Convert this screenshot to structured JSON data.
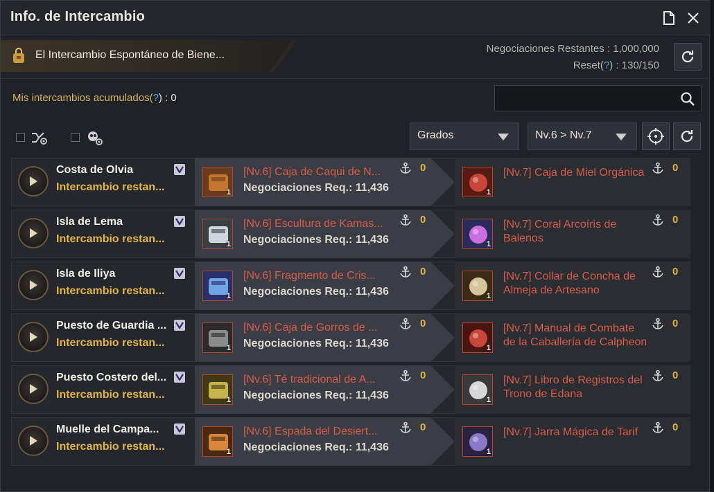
{
  "window": {
    "title": "Info. de Intercambio"
  },
  "banner": {
    "text": "El Intercambio Espontáneo de Biene..."
  },
  "status": {
    "negotiations_label": "Negociaciones Restantes : 1,000,000",
    "reset_prefix": "Reset(",
    "reset_q": "?",
    "reset_suffix": ") : 130/150"
  },
  "accum": {
    "prefix": "Mis intercambios acumulados(",
    "q": "?",
    "suffix": ") : 0"
  },
  "search": {
    "placeholder": ""
  },
  "filters": {
    "grade_label": "Grados",
    "level_label": "Nv.6 > Nv.7"
  },
  "rows": [
    {
      "town": "Costa de Olvia",
      "remain": "Intercambio restan...",
      "give_name": "[Nv.6] Caja de Caqui de N...",
      "give_req": "Negociaciones Req.: 11,436",
      "give_qty": "1",
      "give_count": "0",
      "get_name": "[Nv.7] Caja de Miel Orgánica",
      "get_qty": "1",
      "get_count": "0"
    },
    {
      "town": "Isla de Lema",
      "remain": "Intercambio restan...",
      "give_name": "[Nv.6] Escultura de Kamas...",
      "give_req": "Negociaciones Req.: 11,436",
      "give_qty": "1",
      "give_count": "0",
      "get_name": "[Nv.7] Coral Arcoíris de Balenos",
      "get_qty": "1",
      "get_count": "0"
    },
    {
      "town": "Isla de Iliya",
      "remain": "Intercambio restan...",
      "give_name": "[Nv.6] Fragmento de Cris...",
      "give_req": "Negociaciones Req.: 11,436",
      "give_qty": "1",
      "give_count": "0",
      "get_name": "[Nv.7] Collar de Concha de Almeja de Artesano",
      "get_qty": "1",
      "get_count": "0"
    },
    {
      "town": "Puesto de Guardia ...",
      "remain": "Intercambio restan...",
      "give_name": "[Nv.6] Caja de Gorros de ...",
      "give_req": "Negociaciones Req.: 11,436",
      "give_qty": "1",
      "give_count": "0",
      "get_name": "[Nv.7] Manual de Combate de la Caballería de Calpheon",
      "get_qty": "1",
      "get_count": "0"
    },
    {
      "town": "Puesto Costero del...",
      "remain": "Intercambio restan...",
      "give_name": "[Nv.6] Té tradicional de A...",
      "give_req": "Negociaciones Req.: 11,436",
      "give_qty": "1",
      "give_count": "0",
      "get_name": "[Nv.7] Libro de Registros del Trono de Edana",
      "get_qty": "1",
      "get_count": "0"
    },
    {
      "town": "Muelle del Campa...",
      "remain": "Intercambio restan...",
      "give_name": "[Nv.6] Espada del Desiert...",
      "give_req": "Negociaciones Req.: 11,436",
      "give_qty": "1",
      "give_count": "0",
      "get_name": "[Nv.7] Jarra Mágica de Tarif",
      "get_qty": "1",
      "get_count": "0"
    }
  ],
  "colors": {
    "accent_gold": "#e2b545",
    "item_name_red": "#d85c4a",
    "help_blue": "#4aa9e8"
  }
}
